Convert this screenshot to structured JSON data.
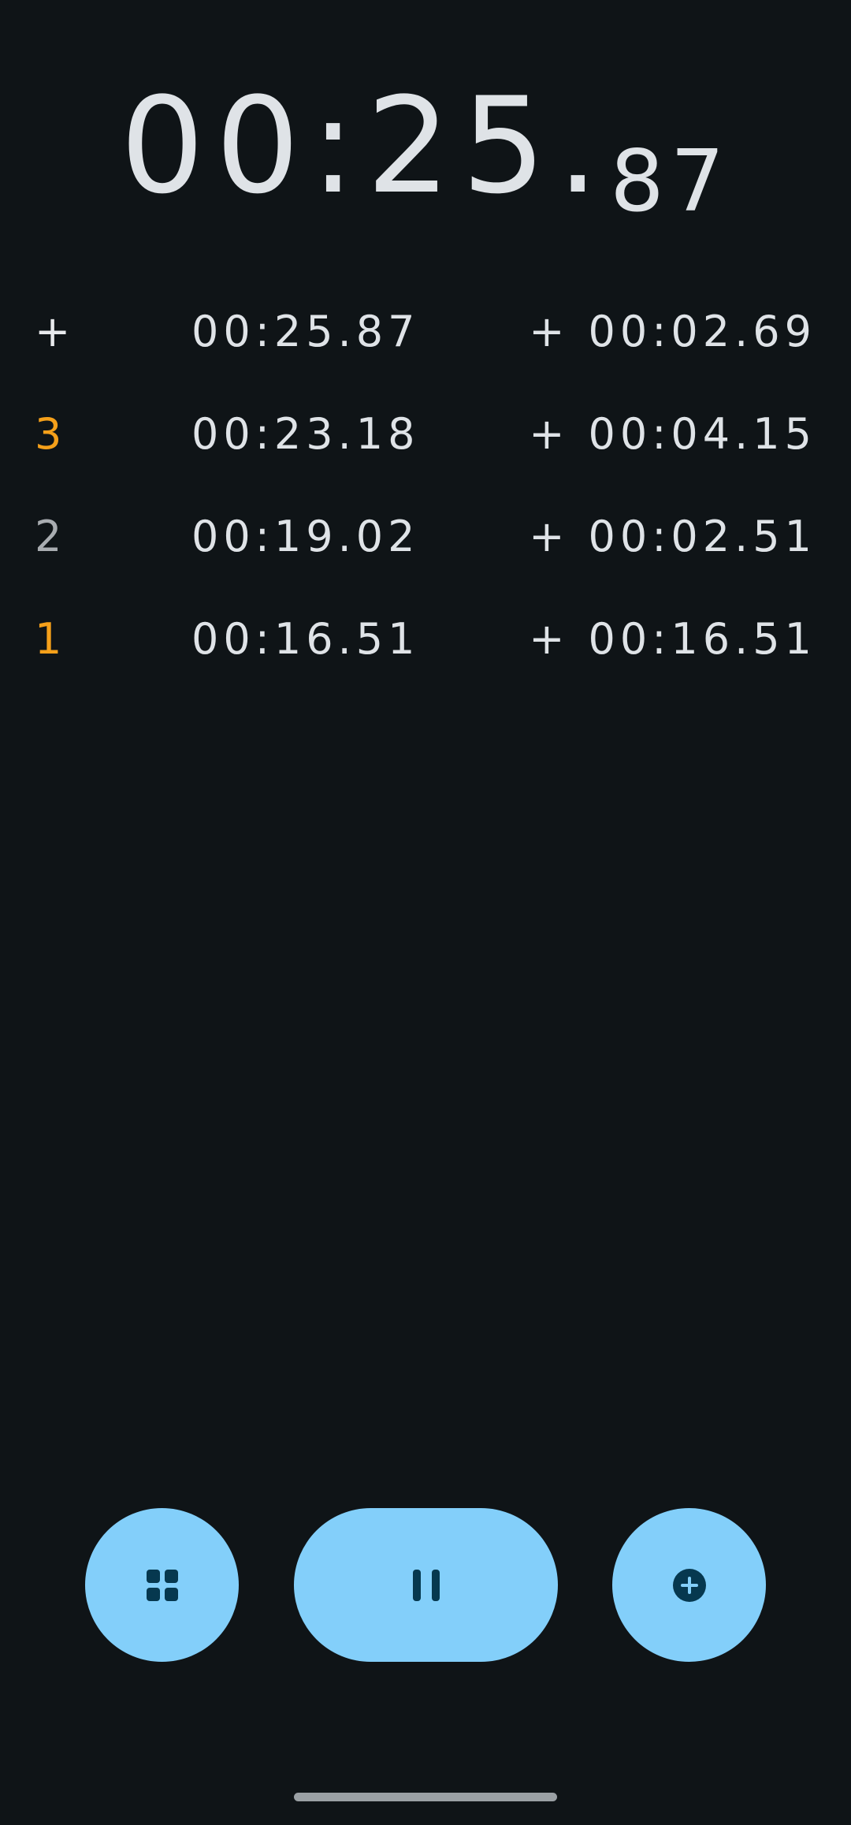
{
  "stopwatch": {
    "main_time": "00:25.",
    "main_hundredths": "87"
  },
  "laps": [
    {
      "number": "+",
      "number_color": "#e8eaed",
      "total": "00:25.87",
      "split_sign": "+",
      "split": "00:02.69"
    },
    {
      "number": "3",
      "number_color": "#f5a01a",
      "total": "00:23.18",
      "split_sign": "+",
      "split": "00:04.15"
    },
    {
      "number": "2",
      "number_color": "#a9adb1",
      "total": "00:19.02",
      "split_sign": "+",
      "split": "00:02.51"
    },
    {
      "number": "1",
      "number_color": "#f5a01a",
      "total": "00:16.51",
      "split_sign": "+",
      "split": "00:16.51"
    }
  ],
  "controls": {
    "reset_icon": "grid-icon",
    "pause_icon": "pause-icon",
    "lap_icon": "add-circle-icon",
    "button_color": "#83cffa",
    "icon_color": "#06384f"
  },
  "theme": {
    "background": "#0f1417",
    "text": "#dfe3e7"
  }
}
